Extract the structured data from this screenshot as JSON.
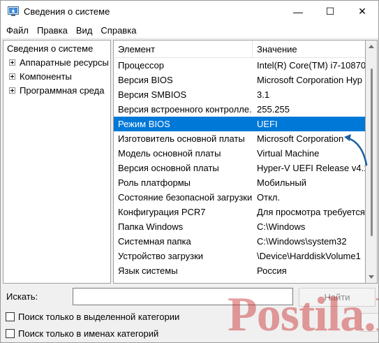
{
  "window": {
    "title": "Сведения о системе",
    "minimize_glyph": "—",
    "maximize_glyph": "☐",
    "close_glyph": "✕"
  },
  "menu": [
    "Файл",
    "Правка",
    "Вид",
    "Справка"
  ],
  "tree": {
    "root": "Сведения о системе",
    "nodes": [
      "Аппаратные ресурсы",
      "Компоненты",
      "Программная среда"
    ]
  },
  "list": {
    "columns": [
      "Элемент",
      "Значение"
    ],
    "rows": [
      {
        "item": "Процессор",
        "value": "Intel(R) Core(TM) i7-10870"
      },
      {
        "item": "Версия BIOS",
        "value": "Microsoft Corporation Hyp"
      },
      {
        "item": "Версия SMBIOS",
        "value": "3.1"
      },
      {
        "item": "Версия встроенного контролле...",
        "value": "255.255"
      },
      {
        "item": "Режим BIOS",
        "value": "UEFI"
      },
      {
        "item": "Изготовитель основной платы",
        "value": "Microsoft Corporation"
      },
      {
        "item": "Модель основной платы",
        "value": "Virtual Machine"
      },
      {
        "item": "Версия основной платы",
        "value": "Hyper-V UEFI Release v4.1"
      },
      {
        "item": "Роль платформы",
        "value": "Мобильный"
      },
      {
        "item": "Состояние безопасной загрузки",
        "value": "Откл."
      },
      {
        "item": "Конфигурация PCR7",
        "value": "Для просмотра требуется"
      },
      {
        "item": "Папка Windows",
        "value": "C:\\Windows"
      },
      {
        "item": "Системная папка",
        "value": "C:\\Windows\\system32"
      },
      {
        "item": "Устройство загрузки",
        "value": "\\Device\\HarddiskVolume1"
      },
      {
        "item": "Язык системы",
        "value": "Россия"
      }
    ],
    "selected_index": 4
  },
  "search": {
    "label": "Искать:",
    "value": "",
    "find_label": "Найти",
    "check_selected": "Поиск только в выделенной категории",
    "check_names": "Поиск только в именах категорий"
  },
  "watermark": "Postila.Ru",
  "colors": {
    "selection": "#0078d7",
    "annotation_arrow": "#1b5fa0"
  }
}
